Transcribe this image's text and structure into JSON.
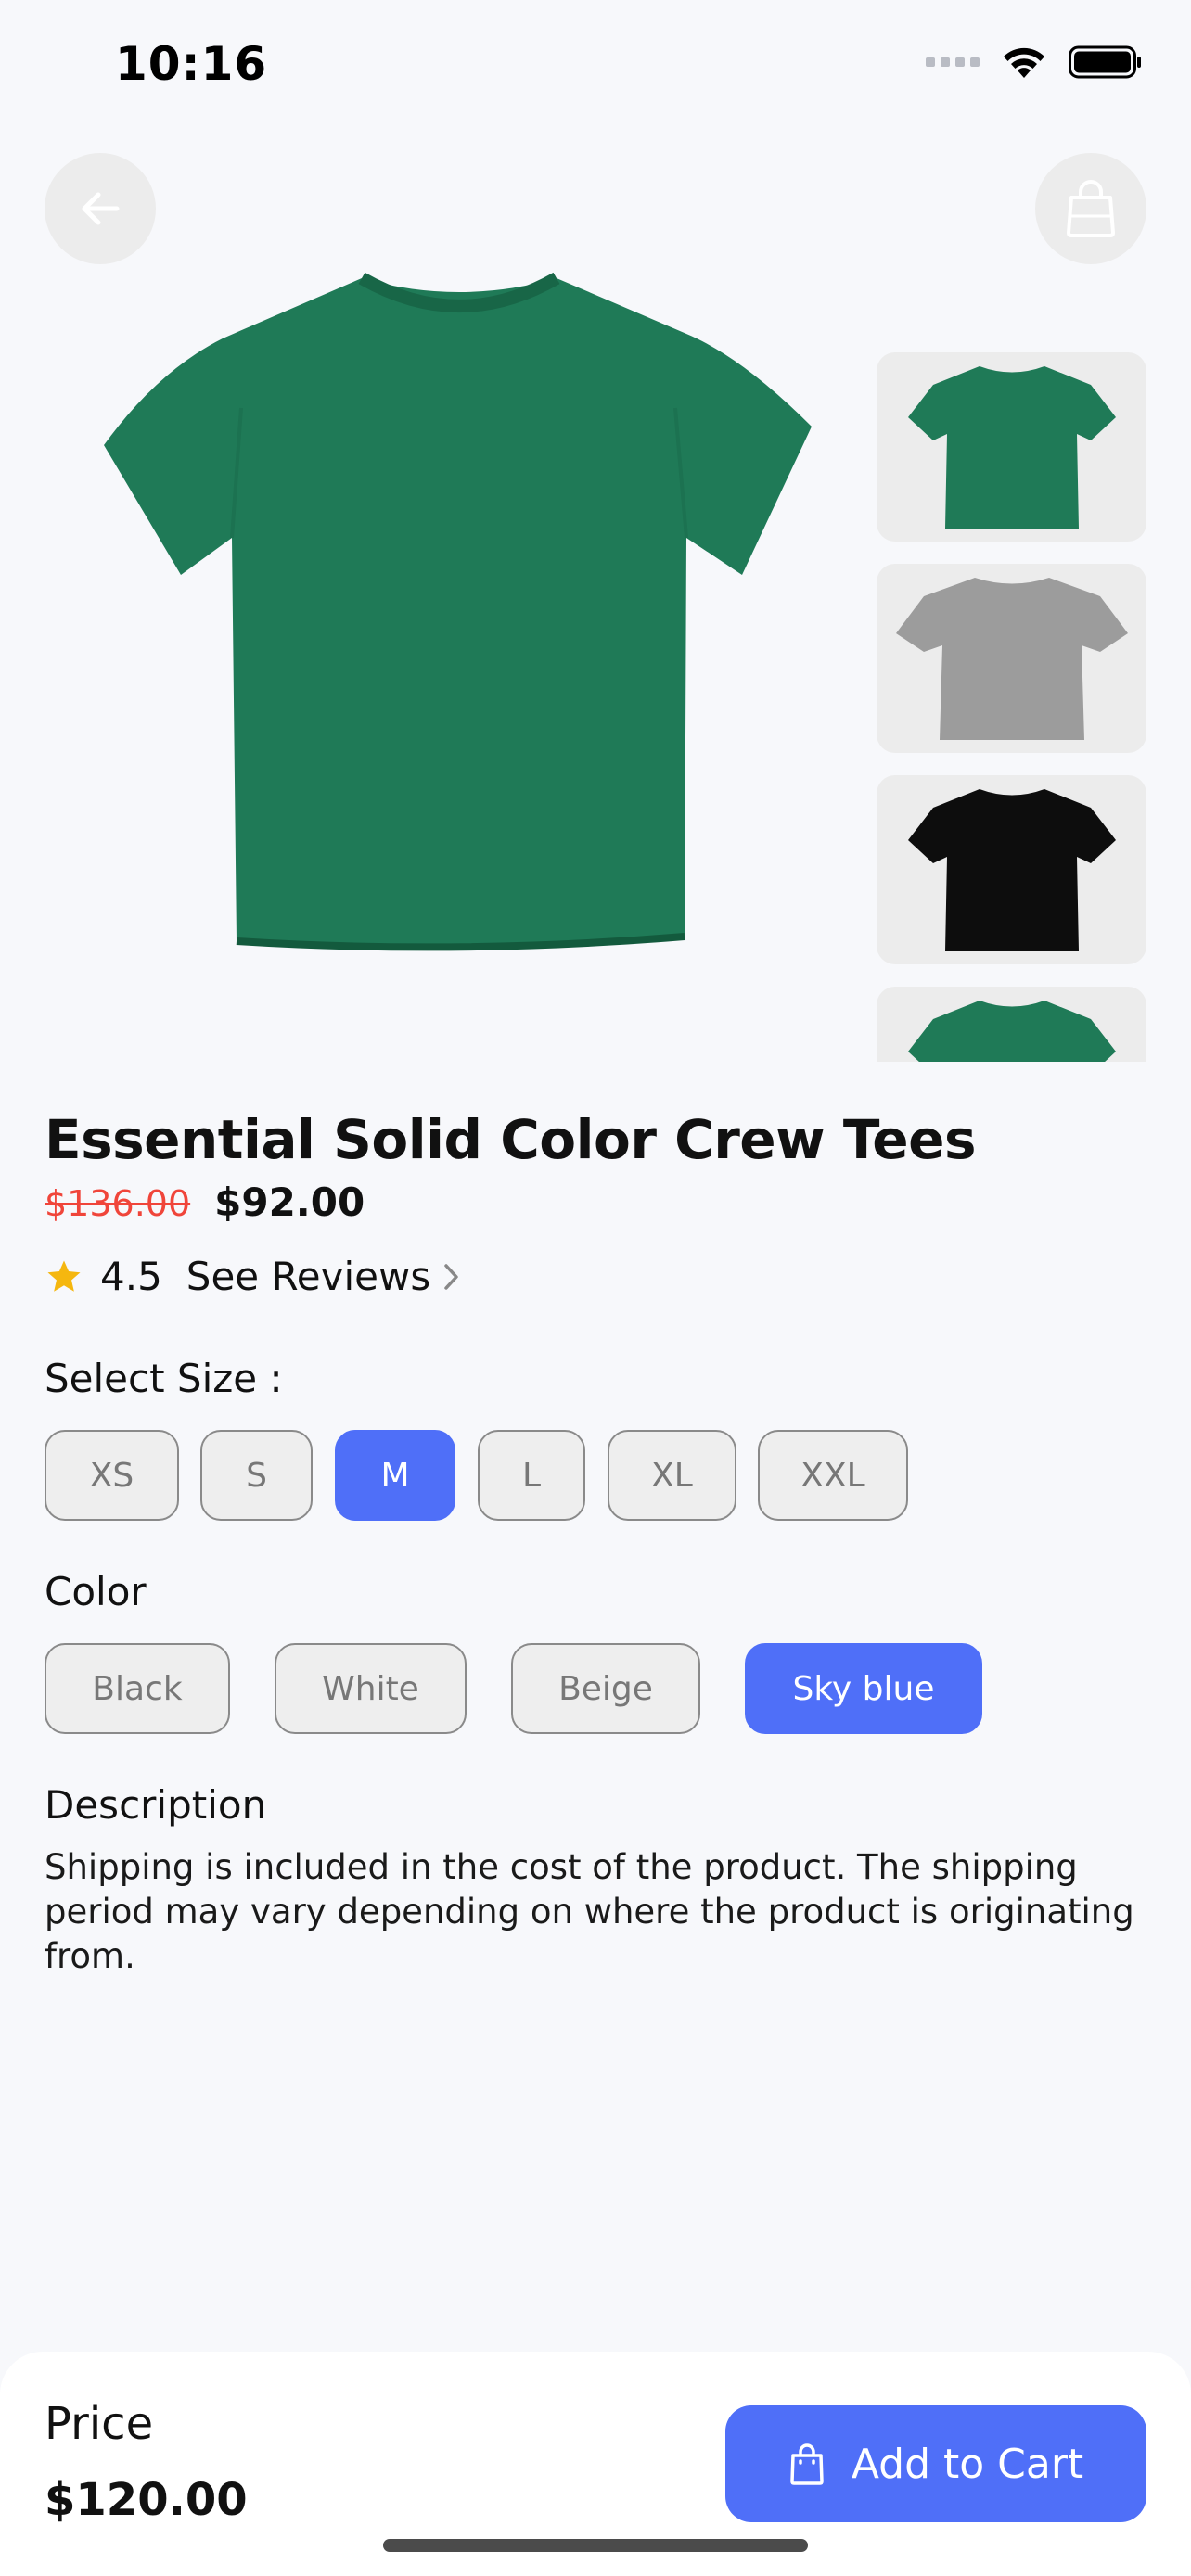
{
  "status_bar": {
    "time": "10:16"
  },
  "product": {
    "title": "Essential Solid Color Crew Tees",
    "old_price": "$136.00",
    "price": "$92.00",
    "rating": "4.5",
    "see_reviews": "See Reviews",
    "main_image_color": "#1f7a57",
    "thumbnails": [
      {
        "color": "#1f7a57",
        "name": "green"
      },
      {
        "color": "#9c9c9c",
        "name": "gray"
      },
      {
        "color": "#0d0d0d",
        "name": "black"
      },
      {
        "color": "#1f7a57",
        "name": "green"
      }
    ]
  },
  "size": {
    "label": "Select Size :",
    "options": [
      "XS",
      "S",
      "M",
      "L",
      "XL",
      "XXL"
    ],
    "selected": "M"
  },
  "color": {
    "label": "Color",
    "options": [
      "Black",
      "White",
      "Beige",
      "Sky blue"
    ],
    "selected": "Sky blue"
  },
  "description": {
    "label": "Description",
    "text": "Shipping is included in the cost of the product. The shipping period may vary depending on where the product is originating from."
  },
  "bottom_bar": {
    "price_label": "Price",
    "price_total": "$120.00",
    "cart_button": "Add to Cart"
  },
  "colors": {
    "accent": "#4f6ff8",
    "strike": "#f0453a",
    "star": "#f5b70f"
  }
}
